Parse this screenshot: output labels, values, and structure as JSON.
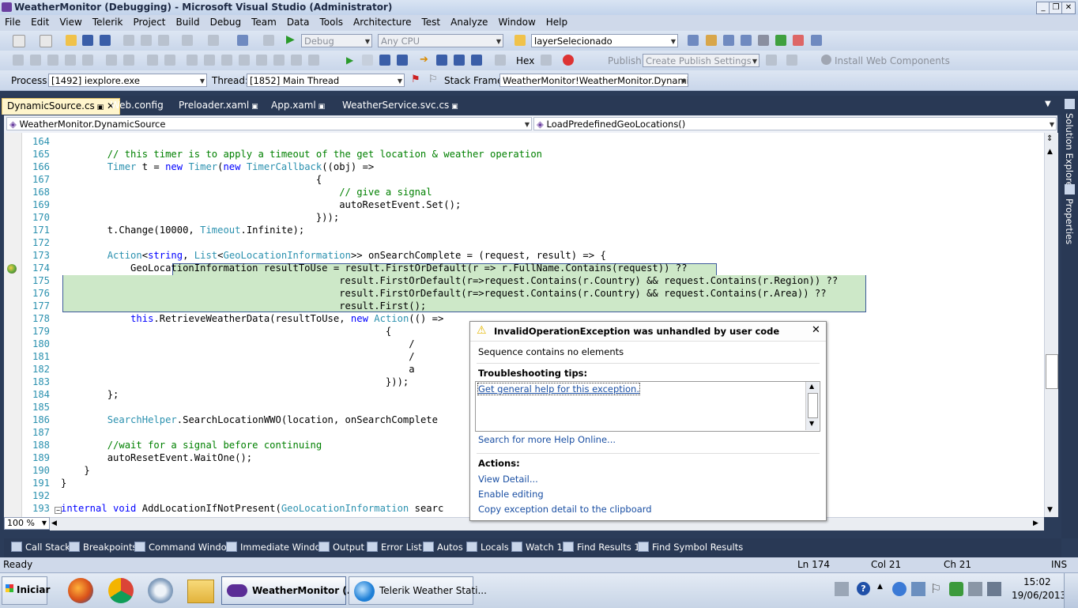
{
  "window": {
    "title": "WeatherMonitor (Debugging) - Microsoft Visual Studio (Administrator)"
  },
  "menu": [
    "File",
    "Edit",
    "View",
    "Telerik",
    "Project",
    "Build",
    "Debug",
    "Team",
    "Data",
    "Tools",
    "Architecture",
    "Test",
    "Analyze",
    "Window",
    "Help"
  ],
  "toolbar1": {
    "config": "Debug",
    "platform": "Any CPU",
    "find": "layerSelecionado"
  },
  "toolbar2": {
    "hex": "Hex",
    "publish_label": "Publish:",
    "publish_value": "Create Publish Settings",
    "install": "Install Web Components"
  },
  "toolbar3": {
    "process_label": "Process:",
    "process": "[1492] iexplore.exe",
    "thread_label": "Thread:",
    "thread": "[1852] Main Thread",
    "stack_label": "Stack Frame:",
    "stack": "WeatherMonitor!WeatherMonitor.DynamicSou"
  },
  "tabs": [
    "DynamicSource.cs",
    "Web.config",
    "Preloader.xaml",
    "App.xaml",
    "WeatherService.svc.cs"
  ],
  "nav": {
    "class": "WeatherMonitor.DynamicSource",
    "member": "LoadPredefinedGeoLocations()"
  },
  "code": {
    "lines": [
      {
        "n": "164",
        "tokens": []
      },
      {
        "n": "165",
        "tokens": [
          {
            "t": "        "
          },
          {
            "t": "// this timer is to apply a timeout of the get location & weather operation",
            "c": "c"
          }
        ]
      },
      {
        "n": "166",
        "tokens": [
          {
            "t": "        "
          },
          {
            "t": "Timer",
            "c": "t"
          },
          {
            "t": " t = "
          },
          {
            "t": "new",
            "c": "k"
          },
          {
            "t": " "
          },
          {
            "t": "Timer",
            "c": "t"
          },
          {
            "t": "("
          },
          {
            "t": "new",
            "c": "k"
          },
          {
            "t": " "
          },
          {
            "t": "TimerCallback",
            "c": "t"
          },
          {
            "t": "((obj) =>"
          }
        ]
      },
      {
        "n": "167",
        "tokens": [
          {
            "t": "                                            {"
          }
        ]
      },
      {
        "n": "168",
        "tokens": [
          {
            "t": "                                                "
          },
          {
            "t": "// give a signal",
            "c": "c"
          }
        ]
      },
      {
        "n": "169",
        "tokens": [
          {
            "t": "                                                autoResetEvent.Set();"
          }
        ]
      },
      {
        "n": "170",
        "tokens": [
          {
            "t": "                                            }));"
          }
        ]
      },
      {
        "n": "171",
        "tokens": [
          {
            "t": "        t.Change(10000, "
          },
          {
            "t": "Timeout",
            "c": "t"
          },
          {
            "t": ".Infinite);"
          }
        ]
      },
      {
        "n": "172",
        "tokens": []
      },
      {
        "n": "173",
        "tokens": [
          {
            "t": "        "
          },
          {
            "t": "Action",
            "c": "t"
          },
          {
            "t": "<"
          },
          {
            "t": "string",
            "c": "k"
          },
          {
            "t": ", "
          },
          {
            "t": "List",
            "c": "t"
          },
          {
            "t": "<"
          },
          {
            "t": "GeoLocationInformation",
            "c": "t"
          },
          {
            "t": ">> onSearchComplete = (request, result) => {"
          }
        ]
      },
      {
        "n": "174",
        "tokens": [
          {
            "t": "            GeoLocationInformation resultToUse = result.FirstOrDefault(r => r.FullName.Contains(request)) ??"
          }
        ]
      },
      {
        "n": "175",
        "tokens": [
          {
            "t": "                                                result.FirstOrDefault(r=>request.Contains(r.Country) && request.Contains(r.Region)) ??"
          }
        ]
      },
      {
        "n": "176",
        "tokens": [
          {
            "t": "                                                result.FirstOrDefault(r=>request.Contains(r.Country) && request.Contains(r.Area)) ??"
          }
        ]
      },
      {
        "n": "177",
        "tokens": [
          {
            "t": "                                                result.First();"
          }
        ]
      },
      {
        "n": "178",
        "tokens": [
          {
            "t": "            "
          },
          {
            "t": "this",
            "c": "k"
          },
          {
            "t": ".RetrieveWeatherData(resultToUse, "
          },
          {
            "t": "new",
            "c": "k"
          },
          {
            "t": " "
          },
          {
            "t": "Action",
            "c": "t"
          },
          {
            "t": "(() =>"
          }
        ]
      },
      {
        "n": "179",
        "tokens": [
          {
            "t": "                                                        {"
          }
        ]
      },
      {
        "n": "180",
        "tokens": [
          {
            "t": "                                                            /"
          }
        ]
      },
      {
        "n": "181",
        "tokens": [
          {
            "t": "                                                            /"
          }
        ]
      },
      {
        "n": "182",
        "tokens": [
          {
            "t": "                                                            a"
          }
        ]
      },
      {
        "n": "183",
        "tokens": [
          {
            "t": "                                                        }));"
          }
        ]
      },
      {
        "n": "184",
        "tokens": [
          {
            "t": "        };"
          }
        ]
      },
      {
        "n": "185",
        "tokens": []
      },
      {
        "n": "186",
        "tokens": [
          {
            "t": "        "
          },
          {
            "t": "SearchHelper",
            "c": "t"
          },
          {
            "t": ".SearchLocationWWO(location, onSearchComplete"
          }
        ]
      },
      {
        "n": "187",
        "tokens": []
      },
      {
        "n": "188",
        "tokens": [
          {
            "t": "        "
          },
          {
            "t": "//wait for a signal before continuing",
            "c": "c"
          }
        ]
      },
      {
        "n": "189",
        "tokens": [
          {
            "t": "        autoResetEvent.WaitOne();"
          }
        ]
      },
      {
        "n": "190",
        "tokens": [
          {
            "t": "    }"
          }
        ]
      },
      {
        "n": "191",
        "tokens": [
          {
            "t": "}"
          }
        ]
      },
      {
        "n": "192",
        "tokens": []
      },
      {
        "n": "193",
        "tokens": [
          {
            "t": "internal",
            "c": "k"
          },
          {
            "t": " "
          },
          {
            "t": "void",
            "c": "k"
          },
          {
            "t": " AddLocationIfNotPresent("
          },
          {
            "t": "GeoLocationInformation",
            "c": "t"
          },
          {
            "t": " searc"
          }
        ]
      }
    ]
  },
  "zoom": "100 %",
  "exception": {
    "title": "InvalidOperationException was unhandled by user code",
    "message": "Sequence contains no elements",
    "tips_title": "Troubleshooting tips:",
    "tip_link": "Get general help for this exception.",
    "search_link": "Search for more Help Online...",
    "actions_title": "Actions:",
    "actions": [
      "View Detail...",
      "Enable editing",
      "Copy exception detail to the clipboard"
    ]
  },
  "right_panels": [
    "Solution Explorer",
    "Properties"
  ],
  "tool_tabs": [
    "Call Stack",
    "Breakpoints",
    "Command Window",
    "Immediate Window",
    "Output",
    "Error List",
    "Autos",
    "Locals",
    "Watch 1",
    "Find Results 1",
    "Find Symbol Results"
  ],
  "status": {
    "ready": "Ready",
    "ln": "Ln 174",
    "col": "Col 21",
    "ch": "Ch 21",
    "ins": "INS"
  },
  "taskbar": {
    "start": "Iniciar",
    "task1": "WeatherMonitor (...",
    "task2": "Telerik Weather Stati...",
    "time": "15:02",
    "date": "19/06/2013"
  },
  "colors": {
    "accent": "#293955",
    "highlight": "#cde8c8",
    "keyword": "#0000ff",
    "type": "#2b91af",
    "comment": "#008000"
  }
}
